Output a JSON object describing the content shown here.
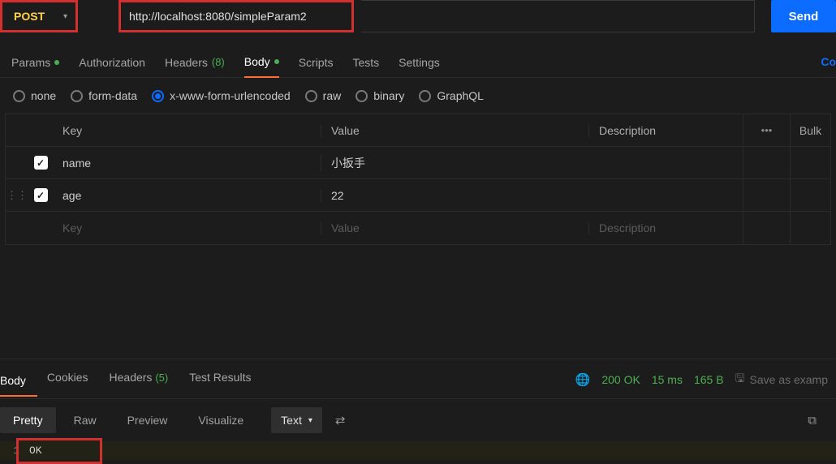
{
  "request": {
    "method": "POST",
    "url": "http://localhost:8080/simpleParam2",
    "send_label": "Send"
  },
  "req_tabs": {
    "params": "Params",
    "authorization": "Authorization",
    "headers": "Headers",
    "headers_count": "(8)",
    "body": "Body",
    "scripts": "Scripts",
    "tests": "Tests",
    "settings": "Settings",
    "cookies_link": "Co"
  },
  "body_types": {
    "none": "none",
    "form_data": "form-data",
    "urlencoded": "x-www-form-urlencoded",
    "raw": "raw",
    "binary": "binary",
    "graphql": "GraphQL"
  },
  "kv": {
    "headers": {
      "key": "Key",
      "value": "Value",
      "description": "Description",
      "bulk": "Bulk"
    },
    "rows": [
      {
        "key": "name",
        "value": "小扳手"
      },
      {
        "key": "age",
        "value": "22"
      }
    ],
    "placeholder": {
      "key": "Key",
      "value": "Value",
      "description": "Description"
    }
  },
  "response": {
    "tabs": {
      "body": "Body",
      "cookies": "Cookies",
      "headers": "Headers",
      "headers_count": "(5)",
      "test_results": "Test Results"
    },
    "status": {
      "code": "200 OK",
      "time": "15 ms",
      "size": "165 B"
    },
    "save_example": "Save as examp",
    "views": {
      "pretty": "Pretty",
      "raw": "Raw",
      "preview": "Preview",
      "visualize": "Visualize"
    },
    "format": "Text",
    "body_lines": [
      {
        "num": "1",
        "text": "OK"
      }
    ]
  }
}
